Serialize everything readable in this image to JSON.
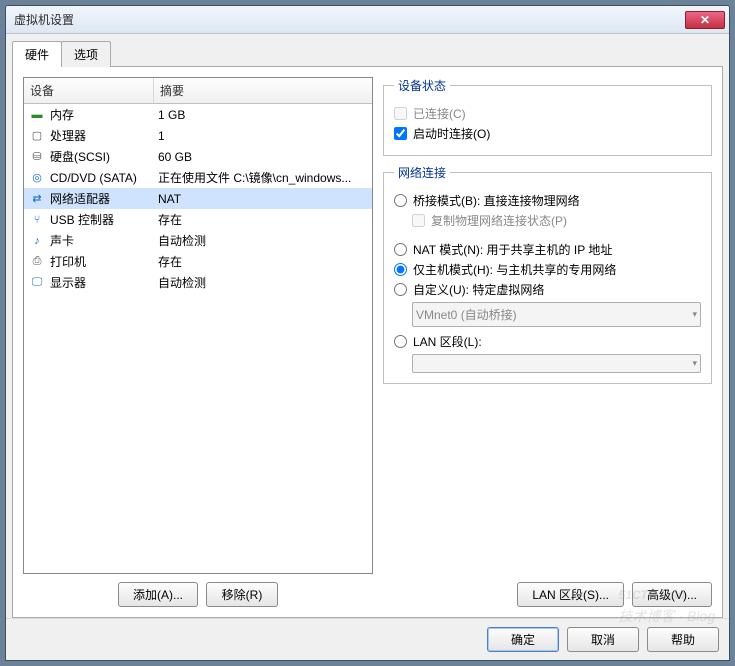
{
  "window": {
    "title": "虚拟机设置"
  },
  "tabs": {
    "hardware": "硬件",
    "options": "选项"
  },
  "table": {
    "header_device": "设备",
    "header_summary": "摘要"
  },
  "devices": [
    {
      "icon": "▬",
      "iclass": "ico-mem",
      "name": "内存",
      "summary": "1 GB"
    },
    {
      "icon": "▢",
      "iclass": "ico-cpu",
      "name": "处理器",
      "summary": "1"
    },
    {
      "icon": "⛁",
      "iclass": "ico-hdd",
      "name": "硬盘(SCSI)",
      "summary": "60 GB"
    },
    {
      "icon": "◎",
      "iclass": "ico-cd",
      "name": "CD/DVD (SATA)",
      "summary": "正在使用文件 C:\\镜像\\cn_windows..."
    },
    {
      "icon": "⇄",
      "iclass": "ico-net",
      "name": "网络适配器",
      "summary": "NAT"
    },
    {
      "icon": "⑂",
      "iclass": "ico-usb",
      "name": "USB 控制器",
      "summary": "存在"
    },
    {
      "icon": "♪",
      "iclass": "ico-snd",
      "name": "声卡",
      "summary": "自动检测"
    },
    {
      "icon": "⎙",
      "iclass": "ico-prn",
      "name": "打印机",
      "summary": "存在"
    },
    {
      "icon": "🖵",
      "iclass": "ico-mon",
      "name": "显示器",
      "summary": "自动检测"
    }
  ],
  "selected_device_index": 4,
  "left_buttons": {
    "add": "添加(A)...",
    "remove": "移除(R)"
  },
  "status_group": {
    "legend": "设备状态",
    "connected": "已连接(C)",
    "connected_checked": false,
    "connect_at_power": "启动时连接(O)",
    "connect_at_power_checked": true
  },
  "net_group": {
    "legend": "网络连接",
    "bridged": "桥接模式(B): 直接连接物理网络",
    "replicate": "复制物理网络连接状态(P)",
    "nat": "NAT 模式(N): 用于共享主机的 IP 地址",
    "hostonly": "仅主机模式(H): 与主机共享的专用网络",
    "custom": "自定义(U): 特定虚拟网络",
    "custom_value": "VMnet0 (自动桥接)",
    "lan": "LAN 区段(L):",
    "lan_value": "",
    "selected": "hostonly"
  },
  "adv_buttons": {
    "lan": "LAN 区段(S)...",
    "adv": "高级(V)..."
  },
  "dialog_buttons": {
    "ok": "确定",
    "cancel": "取消",
    "help": "帮助"
  },
  "watermark": {
    "main": "51CTO.com",
    "sub": "技术博客 · Blog"
  }
}
